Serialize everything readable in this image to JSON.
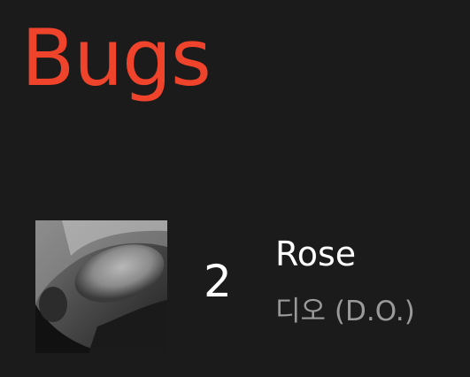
{
  "header": {
    "title": "Bugs",
    "title_color": "#f0432c"
  },
  "chart_entry": {
    "rank": "2",
    "title": "Rose",
    "artist": "디오 (D.O.)",
    "album_art": "grayscale-portrait-image"
  },
  "colors": {
    "background": "#1b1b1b",
    "primary_text": "#ffffff",
    "secondary_text": "#9a9a9a"
  }
}
